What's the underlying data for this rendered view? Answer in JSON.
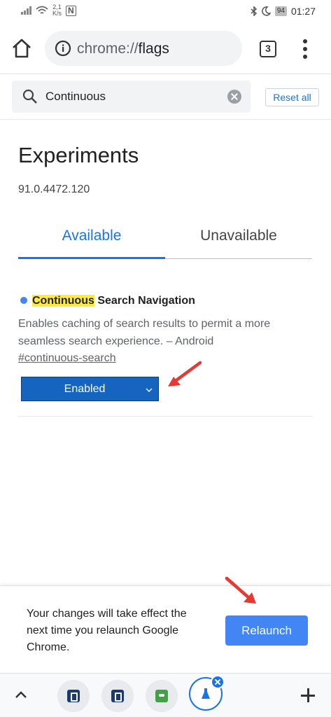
{
  "status_bar": {
    "net_speed_value": "2,1",
    "net_speed_unit": "K/s",
    "nfc_label": "N",
    "battery": "94",
    "time": "01:27"
  },
  "toolbar": {
    "url_scheme": "chrome://",
    "url_host": "flags",
    "tab_count": "3"
  },
  "search": {
    "value": "Continuous",
    "reset_label": "Reset all"
  },
  "main": {
    "title": "Experiments",
    "version": "91.0.4472.120",
    "tabs": [
      {
        "label": "Available",
        "active": true
      },
      {
        "label": "Unavailable",
        "active": false
      }
    ]
  },
  "flag": {
    "name_highlight": "Continuous",
    "name_rest": " Search Navigation",
    "description": "Enables caching of search results to permit a more seamless search experience. – Android",
    "link": "#continuous-search",
    "selected_option": "Enabled"
  },
  "relaunch": {
    "message": "Your changes will take effect the next time you relaunch Google Chrome.",
    "button_label": "Relaunch"
  },
  "colors": {
    "accent": "#1a73e8",
    "button_blue": "#4285f4",
    "select_blue": "#1565c0",
    "highlight": "#ffeb3b",
    "annotation_arrow": "#e53935"
  },
  "icons": [
    "signal-icon",
    "wifi-icon",
    "nfc-icon",
    "bluetooth-icon",
    "moon-icon",
    "battery-icon",
    "home-icon",
    "info-icon",
    "tab-switcher-icon",
    "more-vert-icon",
    "search-icon",
    "clear-icon",
    "chevron-down-icon",
    "chevron-up-icon",
    "flask-icon",
    "close-icon",
    "plus-icon"
  ]
}
